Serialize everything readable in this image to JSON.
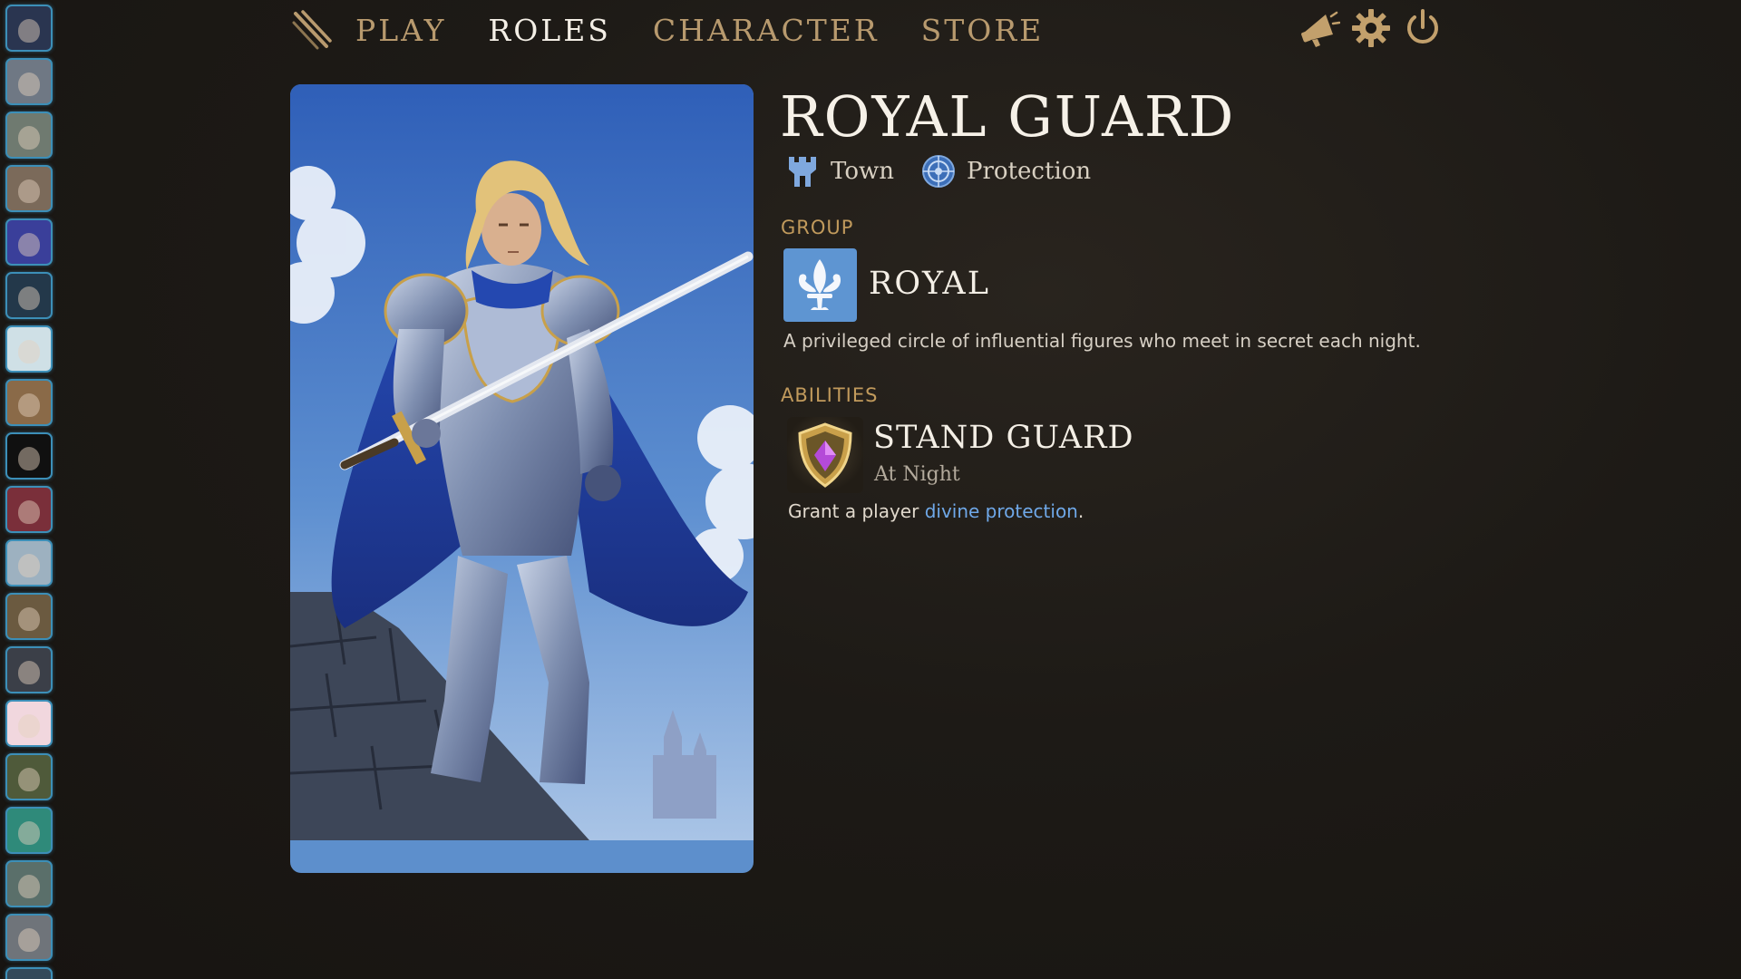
{
  "nav": {
    "items": [
      {
        "label": "PLAY",
        "active": false
      },
      {
        "label": "ROLES",
        "active": true
      },
      {
        "label": "CHARACTER",
        "active": false
      },
      {
        "label": "STORE",
        "active": false
      }
    ],
    "logo_icon": "claw-marks-icon",
    "right_icons": [
      "megaphone-icon",
      "gear-icon",
      "power-icon"
    ]
  },
  "avatars": [
    {
      "icon": "wolf-emblem-avatar",
      "bg": "#2a3550"
    },
    {
      "icon": "old-man-avatar",
      "bg": "#6f7884"
    },
    {
      "icon": "crocodile-avatar",
      "bg": "#6f7a70"
    },
    {
      "icon": "bearded-man-avatar",
      "bg": "#7b6a5a"
    },
    {
      "icon": "pig-avatar",
      "bg": "#3a3f9a"
    },
    {
      "icon": "anime-boy-avatar",
      "bg": "#23384a"
    },
    {
      "icon": "white-hair-girl-avatar",
      "bg": "#cfe0e6"
    },
    {
      "icon": "horse-avatar",
      "bg": "#8a6a48"
    },
    {
      "icon": "stag-avatar",
      "bg": "#101010"
    },
    {
      "icon": "red-scene-avatar",
      "bg": "#7a2f3a"
    },
    {
      "icon": "glasses-guy-avatar",
      "bg": "#9db1c0"
    },
    {
      "icon": "hat-creature-avatar",
      "bg": "#6b5a40"
    },
    {
      "icon": "dark-figure-avatar",
      "bg": "#3b3f48"
    },
    {
      "icon": "pink-hair-girl-avatar",
      "bg": "#f1d7de"
    },
    {
      "icon": "soldier-avatar",
      "bg": "#4f5a3a"
    },
    {
      "icon": "green-hair-girl-avatar",
      "bg": "#2f8a7a"
    },
    {
      "icon": "dancer-avatar",
      "bg": "#5a6f6a"
    },
    {
      "icon": "cigar-man-avatar",
      "bg": "#6f747a"
    },
    {
      "icon": "partial-avatar",
      "bg": "#34495a"
    }
  ],
  "role": {
    "title": "ROYAL GUARD",
    "tags": [
      {
        "icon": "castle-tower-icon",
        "label": "Town"
      },
      {
        "icon": "round-shield-icon",
        "label": "Protection"
      }
    ],
    "group_label": "GROUP",
    "group": {
      "icon": "fleur-de-lis-icon",
      "name": "ROYAL",
      "description": "A privileged circle of influential figures who meet in secret each night."
    },
    "abilities_label": "ABILITIES",
    "ability": {
      "icon": "gem-shield-icon",
      "name": "STAND GUARD",
      "time": "At Night",
      "desc_prefix": "Grant a player ",
      "desc_keyword": "divine protection",
      "desc_suffix": "."
    },
    "portrait": "armored-knight-portrait"
  },
  "colors": {
    "background": "#1c1915",
    "nav_inactive": "#b89a6e",
    "nav_active": "#f4efe6",
    "section_label": "#c19a5c",
    "keyword_link": "#6fa8e8",
    "group_badge": "#5e95d2",
    "avatar_border": "#3c8fb8"
  }
}
